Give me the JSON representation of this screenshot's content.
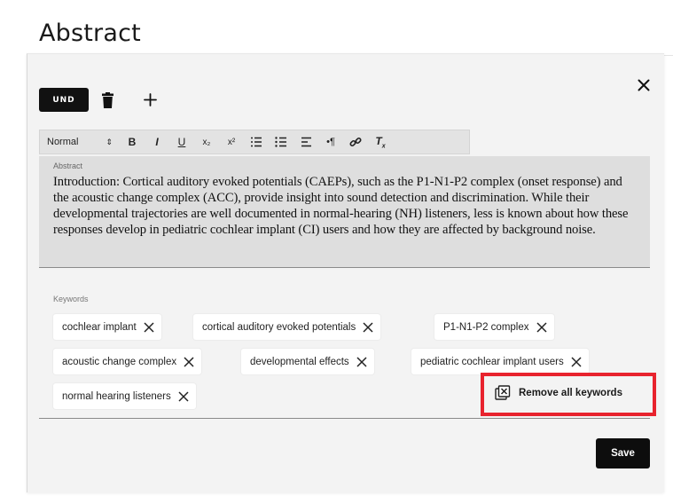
{
  "page": {
    "title": "Abstract"
  },
  "editor": {
    "und_label": "UND",
    "toolbar": {
      "style_select": "Normal",
      "buttons": [
        {
          "name": "bold",
          "glyph": "B"
        },
        {
          "name": "italic",
          "glyph": "I"
        },
        {
          "name": "underline",
          "glyph": "U"
        },
        {
          "name": "subscript",
          "glyph": "x₂"
        },
        {
          "name": "superscript",
          "glyph": "x²"
        },
        {
          "name": "ordered-list",
          "glyph": "≡"
        },
        {
          "name": "bullet-list",
          "glyph": "≡"
        },
        {
          "name": "align",
          "glyph": "≡"
        },
        {
          "name": "text-direction",
          "glyph": "•¶"
        },
        {
          "name": "link",
          "glyph": "🔗"
        },
        {
          "name": "clear-format",
          "glyph": "Tx"
        }
      ]
    },
    "abstract": {
      "label": "Abstract",
      "text": "Introduction: Cortical auditory evoked potentials (CAEPs), such as the P1-N1-P2 complex (onset response) and the acoustic change complex (ACC), provide insight into sound detection and discrimination. While their developmental trajectories are well documented in normal-hearing (NH) listeners, less is known about how these responses develop in pediatric cochlear implant (CI) users and how they are affected by background noise."
    },
    "keywords": {
      "label": "Keywords",
      "items": [
        "cochlear implant",
        "cortical auditory evoked potentials",
        "P1-N1-P2 complex",
        "acoustic change complex",
        "developmental effects",
        "pediatric cochlear implant users",
        "normal hearing listeners"
      ],
      "remove_all_label": "Remove all keywords"
    },
    "save_label": "Save"
  },
  "colors": {
    "highlight": "#e8232e",
    "primary_button": "#0d0d0d"
  }
}
